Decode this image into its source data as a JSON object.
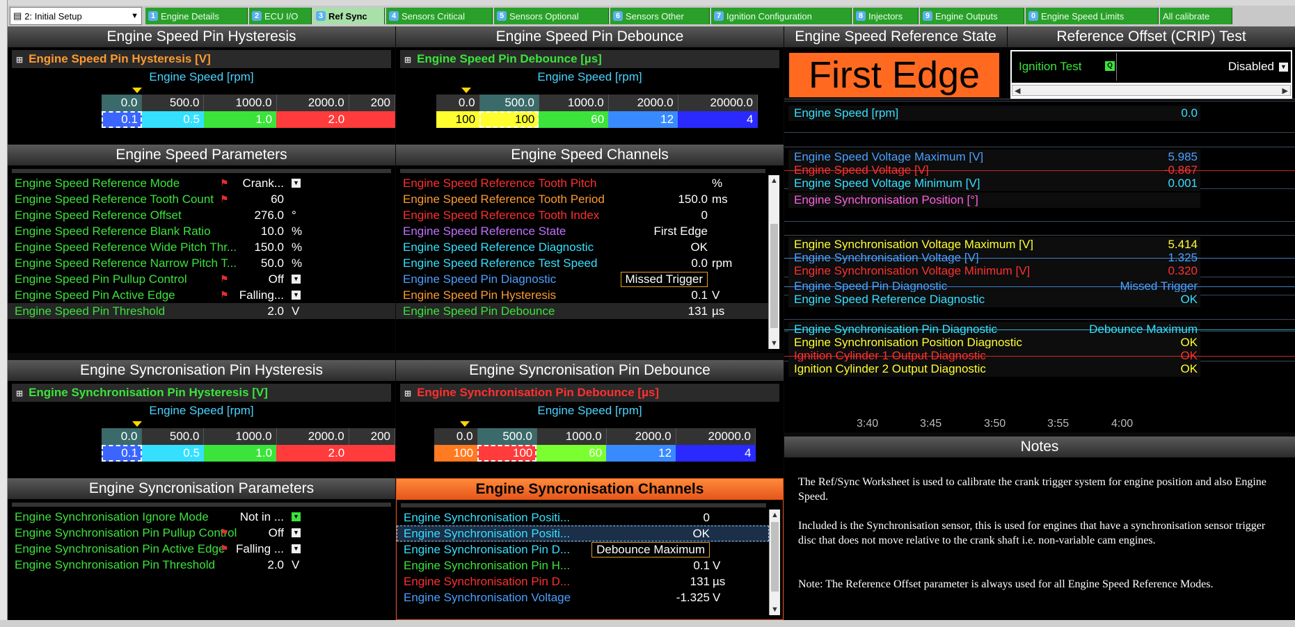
{
  "toolbar": {
    "worksheet": "2: Initial Setup"
  },
  "tabs": [
    {
      "num": "1",
      "label": "Engine Details"
    },
    {
      "num": "2",
      "label": "ECU I/O"
    },
    {
      "num": "3",
      "label": "Ref Sync"
    },
    {
      "num": "4",
      "label": "Sensors Critical"
    },
    {
      "num": "5",
      "label": "Sensors Optional"
    },
    {
      "num": "6",
      "label": "Sensors Other"
    },
    {
      "num": "7",
      "label": "Ignition Configuration"
    },
    {
      "num": "8",
      "label": "Injectors"
    },
    {
      "num": "9",
      "label": "Engine Outputs"
    },
    {
      "num": "0",
      "label": "Engine Speed Limits"
    },
    {
      "num": "",
      "label": "All calibrate"
    }
  ],
  "hyst": {
    "title": "Engine Speed Pin Hysteresis",
    "header": "Engine Speed Pin Hysteresis [V]",
    "axis_label": "Engine Speed [rpm]",
    "axis": [
      "0.0",
      "500.0",
      "1000.0",
      "2000.0",
      "200"
    ],
    "values": [
      "0.1",
      "0.5",
      "1.0",
      "2.0",
      ""
    ],
    "colors": [
      "#3a66ff",
      "#35e0ff",
      "#3be33b",
      "#ff3b3b",
      "#ff3b3b"
    ]
  },
  "deb": {
    "title": "Engine Speed Pin Debounce",
    "header": "Engine Speed Pin Debounce [µs]",
    "axis_label": "Engine Speed [rpm]",
    "axis": [
      "0.0",
      "500.0",
      "1000.0",
      "2000.0",
      "20000.0"
    ],
    "values": [
      "100",
      "100",
      "60",
      "12",
      "4"
    ],
    "colors": [
      "#ffff30",
      "#ffff30",
      "#3be33b",
      "#3a8aff",
      "#2a2aff"
    ]
  },
  "params": {
    "title": "Engine Speed Parameters",
    "rows": [
      {
        "name": "Engine Speed Reference Mode",
        "value": "Crank...",
        "unit": "",
        "flag": true,
        "dd": true
      },
      {
        "name": "Engine Speed Reference Tooth Count",
        "value": "60",
        "unit": "",
        "flag": true,
        "dd": false
      },
      {
        "name": "Engine Speed Reference Offset",
        "value": "276.0",
        "unit": "°",
        "flag": false,
        "dd": false
      },
      {
        "name": "Engine Speed Reference Blank Ratio",
        "value": "10.0",
        "unit": "%",
        "flag": false,
        "dd": false
      },
      {
        "name": "Engine Speed Reference Wide Pitch Thr...",
        "value": "150.0",
        "unit": "%",
        "flag": false,
        "dd": false
      },
      {
        "name": "Engine Speed Reference Narrow Pitch T...",
        "value": "50.0",
        "unit": "%",
        "flag": false,
        "dd": false
      },
      {
        "name": "Engine Speed Pin Pullup Control",
        "value": "Off",
        "unit": "",
        "flag": true,
        "dd": true
      },
      {
        "name": "Engine Speed Pin Active Edge",
        "value": "Falling...",
        "unit": "",
        "flag": true,
        "dd": true
      },
      {
        "name": "Engine Speed Pin Threshold",
        "value": "2.0",
        "unit": "V",
        "flag": false,
        "dd": false
      }
    ]
  },
  "channels": {
    "title": "Engine Speed Channels",
    "rows": [
      {
        "name": "Engine Speed Reference Tooth Pitch",
        "value": "",
        "unit": "%",
        "color": "#ff3030",
        "boxed": false
      },
      {
        "name": "Engine Speed Reference Tooth Period",
        "value": "150.0",
        "unit": "ms",
        "color": "#ff9a30",
        "boxed": false
      },
      {
        "name": "Engine Speed Reference Tooth Index",
        "value": "0",
        "unit": "",
        "color": "#ff3030",
        "boxed": false
      },
      {
        "name": "Engine Speed Reference State",
        "value": "First Edge",
        "unit": "",
        "color": "#c070ff",
        "boxed": false
      },
      {
        "name": "Engine Speed Reference Diagnostic",
        "value": "OK",
        "unit": "",
        "color": "#35e0ff",
        "boxed": false
      },
      {
        "name": "Engine Speed Reference Test Speed",
        "value": "0.0",
        "unit": "rpm",
        "color": "#35e0ff",
        "boxed": false
      },
      {
        "name": "Engine Speed Pin Diagnostic",
        "value": "Missed Trigger",
        "unit": "",
        "color": "#4aa0ff",
        "boxed": true
      },
      {
        "name": "Engine Speed Pin Hysteresis",
        "value": "0.1",
        "unit": "V",
        "color": "#ff9a30",
        "boxed": false
      },
      {
        "name": "Engine Speed Pin Debounce",
        "value": "131",
        "unit": "µs",
        "color": "#3be33b",
        "boxed": false
      }
    ]
  },
  "shyst": {
    "title": "Engine Syncronisation Pin Hysteresis",
    "header": "Engine Synchronisation Pin Hysteresis [V]",
    "axis_label": "Engine Speed [rpm]",
    "axis": [
      "0.0",
      "500.0",
      "1000.0",
      "2000.0",
      "200"
    ],
    "values": [
      "0.1",
      "0.5",
      "1.0",
      "2.0",
      ""
    ],
    "colors": [
      "#3a66ff",
      "#35e0ff",
      "#3be33b",
      "#ff3b3b",
      "#ff3b3b"
    ]
  },
  "sdeb": {
    "title": "Engine Syncronisation Pin Debounce",
    "header": "Engine Synchronisation Pin Debounce [µs]",
    "axis_label": "Engine Speed [rpm]",
    "axis": [
      "0.0",
      "500.0",
      "1000.0",
      "2000.0",
      "20000.0"
    ],
    "values": [
      "100",
      "100",
      "60",
      "12",
      "4"
    ],
    "colors": [
      "#ff7a20",
      "#ff3b3b",
      "#7aff30",
      "#3a8aff",
      "#2a2aff"
    ]
  },
  "sparams": {
    "title": "Engine Syncronisation Parameters",
    "rows": [
      {
        "name": "Engine Synchronisation Ignore Mode",
        "value": "Not in ...",
        "unit": "",
        "flag": false,
        "dd": true
      },
      {
        "name": "Engine Synchronisation Pin Pullup Control",
        "value": "Off",
        "unit": "",
        "flag": true,
        "dd": true
      },
      {
        "name": "Engine Synchronisation Pin Active Edge",
        "value": "Falling ...",
        "unit": "",
        "flag": true,
        "dd": true
      },
      {
        "name": "Engine Synchronisation Pin Threshold",
        "value": "2.0",
        "unit": "V",
        "flag": false,
        "dd": false
      }
    ]
  },
  "schannels": {
    "title": "Engine Syncronisation Channels",
    "rows": [
      {
        "name": "Engine Synchronisation Positi...",
        "value": "0",
        "unit": "",
        "color": "#35e0ff",
        "boxed": false
      },
      {
        "name": "Engine Synchronisation Positi...",
        "value": "OK",
        "unit": "",
        "color": "#35e0ff",
        "boxed": false
      },
      {
        "name": "Engine Synchronisation Pin D...",
        "value": "Debounce Maximum",
        "unit": "",
        "color": "#35e0ff",
        "boxed": true
      },
      {
        "name": "Engine Synchronisation Pin H...",
        "value": "0.1",
        "unit": "V",
        "color": "#3be33b",
        "boxed": false
      },
      {
        "name": "Engine Synchronisation Pin D...",
        "value": "131",
        "unit": "µs",
        "color": "#ff3030",
        "boxed": false
      },
      {
        "name": "Engine Synchronisation Voltage",
        "value": "-1.325",
        "unit": "V",
        "color": "#4aa0ff",
        "boxed": false
      }
    ]
  },
  "state": {
    "title": "Engine Speed Reference State",
    "value": "First Edge"
  },
  "offset": {
    "title": "Reference Offset (CRIP) Test",
    "label": "Ignition Test",
    "value": "Disabled"
  },
  "graph": {
    "items": [
      {
        "label": "Engine Speed [rpm]",
        "value": "0.0",
        "color": "#35e0ff"
      },
      {
        "label": "Engine Speed Voltage Maximum [V]",
        "value": "5.985",
        "color": "#4aa0ff"
      },
      {
        "label": "Engine Speed Voltage [V]",
        "value": "-0.867",
        "color": "#ff3030"
      },
      {
        "label": "Engine Speed Voltage Minimum [V]",
        "value": "0.001",
        "color": "#35e0ff"
      },
      {
        "label": "Engine Synchronisation Position [°]",
        "value": "",
        "color": "#ff60e0"
      },
      {
        "label": "Engine Synchronisation Voltage Maximum [V]",
        "value": "5.414",
        "color": "#ffff30"
      },
      {
        "label": "Engine Synchronisation Voltage [V]",
        "value": "1.325",
        "color": "#4aa0ff"
      },
      {
        "label": "Engine Synchronisation Voltage Minimum [V]",
        "value": "0.320",
        "color": "#ff3030"
      },
      {
        "label": "Engine Speed Pin Diagnostic",
        "value": "Missed Trigger",
        "color": "#4aa0ff"
      },
      {
        "label": "Engine Speed Reference Diagnostic",
        "value": "OK",
        "color": "#35e0ff"
      },
      {
        "label": "Engine Synchronisation Pin Diagnostic",
        "value": "Debounce Maximum",
        "color": "#35e0ff"
      },
      {
        "label": "Engine Synchronisation Position Diagnostic",
        "value": "OK",
        "color": "#ffff30"
      },
      {
        "label": "Ignition Cylinder 1 Output Diagnostic",
        "value": "OK",
        "color": "#ff3030"
      },
      {
        "label": "Ignition Cylinder 2 Output Diagnostic",
        "value": "OK",
        "color": "#ffff30"
      }
    ],
    "times": [
      "3:40",
      "3:45",
      "3:50",
      "3:55",
      "4:00"
    ]
  },
  "notes": {
    "title": "Notes",
    "p1": "The Ref/Sync Worksheet is used to calibrate the crank trigger system for engine position and also Engine Speed.",
    "p2": "Included is the Synchronisation sensor, this is used for engines that have a synchronisation sensor trigger disc that does not move relative to the crank shaft i.e. non-variable cam engines.",
    "p3": "Note:  The Reference Offset parameter is always used for all Engine Speed Reference Modes."
  }
}
